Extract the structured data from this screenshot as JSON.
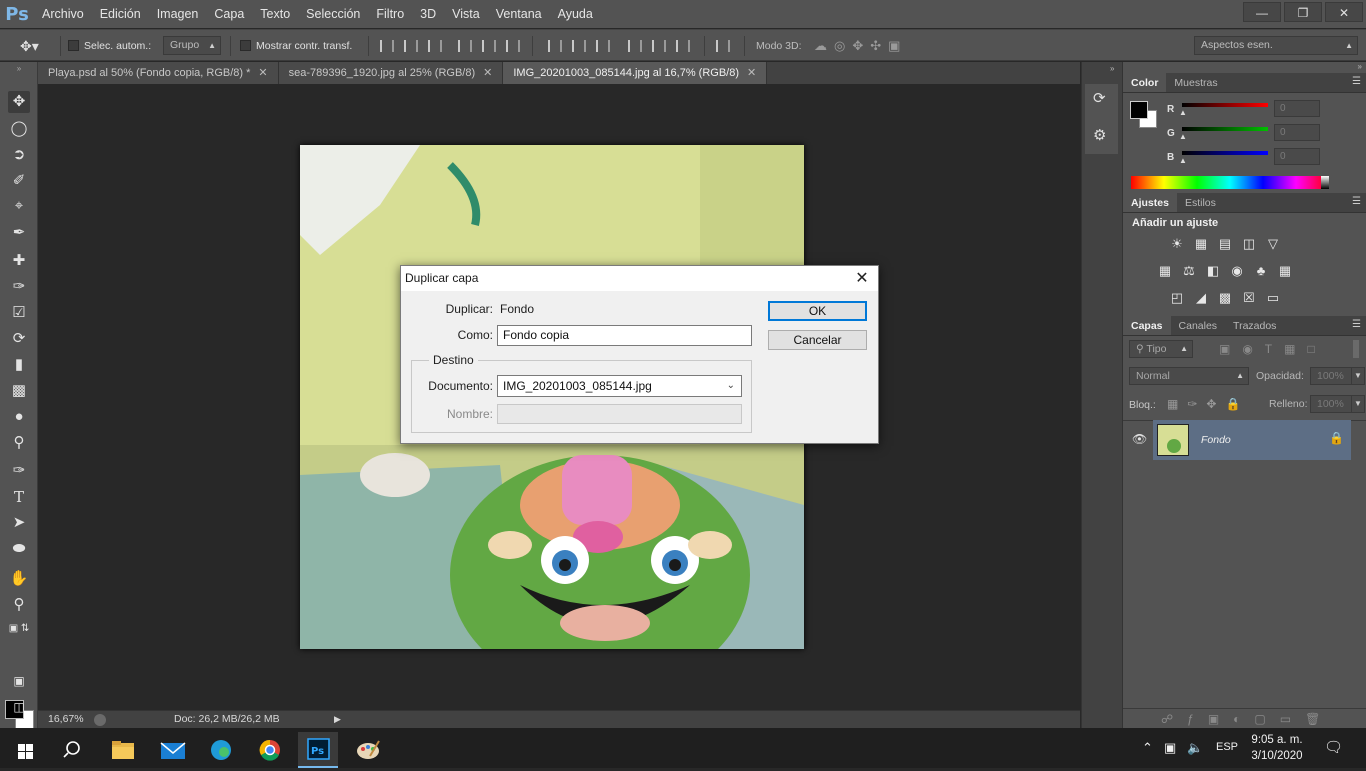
{
  "app": {
    "logo": "Ps",
    "menu": [
      "Archivo",
      "Edición",
      "Imagen",
      "Capa",
      "Texto",
      "Selección",
      "Filtro",
      "3D",
      "Vista",
      "Ventana",
      "Ayuda"
    ],
    "window_controls": [
      "minimize-icon",
      "restore-icon",
      "close-icon"
    ]
  },
  "options_bar": {
    "auto_select_label": "Selec. autom.:",
    "auto_select_target": "Grupo",
    "show_transform_label": "Mostrar contr. transf.",
    "mode_3d_label": "Modo 3D:",
    "workspace": "Aspectos esen."
  },
  "tabs": [
    {
      "label": "Playa.psd al 50% (Fondo copia, RGB/8) *",
      "active": false
    },
    {
      "label": "sea-789396_1920.jpg al 25% (RGB/8)",
      "active": false
    },
    {
      "label": "IMG_20201003_085144.jpg al 16,7% (RGB/8)",
      "active": true
    }
  ],
  "status": {
    "zoom": "16,67%",
    "doc": "Doc: 26,2 MB/26,2 MB"
  },
  "color_panel": {
    "tabs": [
      "Color",
      "Muestras"
    ],
    "channels": [
      {
        "label": "R",
        "value": "0",
        "color": "#ff0000"
      },
      {
        "label": "G",
        "value": "0",
        "color": "#00c000"
      },
      {
        "label": "B",
        "value": "0",
        "color": "#0000ff"
      }
    ]
  },
  "adjust_panel": {
    "tabs": [
      "Ajustes",
      "Estilos"
    ],
    "heading": "Añadir un ajuste"
  },
  "layers_panel": {
    "tabs": [
      "Capas",
      "Canales",
      "Trazados"
    ],
    "filter_label": "Tipo",
    "blend_mode": "Normal",
    "opacity_label": "Opacidad:",
    "opacity_value": "100%",
    "lock_label": "Bloq.:",
    "fill_label": "Relleno:",
    "fill_value": "100%",
    "layers": [
      {
        "name": "Fondo",
        "locked": true,
        "visible": true
      }
    ]
  },
  "dialog": {
    "title": "Duplicar capa",
    "duplicate_label": "Duplicar:",
    "duplicate_value": "Fondo",
    "as_label": "Como:",
    "as_value": "Fondo copia",
    "destination_legend": "Destino",
    "document_label": "Documento:",
    "document_value": "IMG_20201003_085144.jpg",
    "name_label": "Nombre:",
    "ok_label": "OK",
    "cancel_label": "Cancelar"
  },
  "taskbar": {
    "language": "ESP",
    "time": "9:05 a. m.",
    "date": "3/10/2020"
  }
}
